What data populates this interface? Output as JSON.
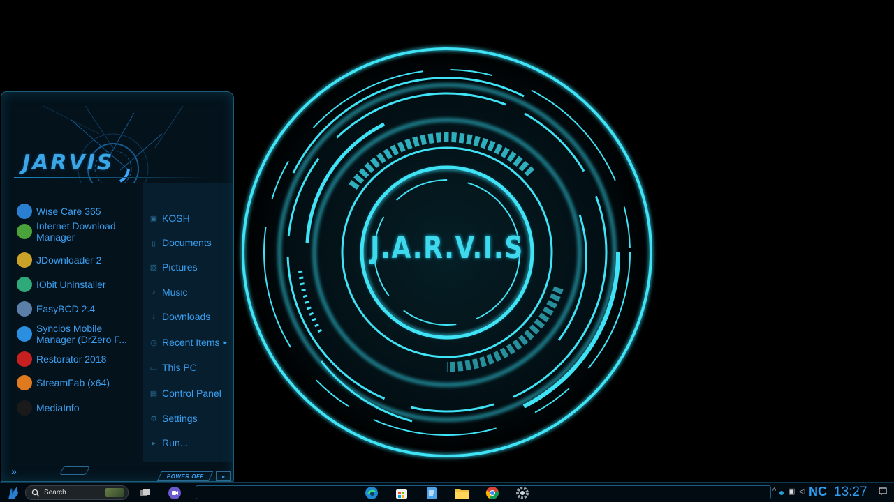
{
  "desktop": {
    "title": "J.A.R.V.I.S",
    "accent_color": "#3fd9ee"
  },
  "start_menu": {
    "brand": "JARVIS",
    "apps": [
      {
        "label": "Wise Care 365",
        "icon": "wise-care-icon",
        "color": "#2a7fd0"
      },
      {
        "label": "Internet Download Manager",
        "icon": "idm-icon",
        "color": "#4aa33a"
      },
      {
        "label": "JDownloader 2",
        "icon": "jdownloader-icon",
        "color": "#c9a227"
      },
      {
        "label": "IObit Uninstaller",
        "icon": "iobit-uninstaller-icon",
        "color": "#2fa87a"
      },
      {
        "label": "EasyBCD 2.4",
        "icon": "easybcd-icon",
        "color": "#5a7fa8"
      },
      {
        "label": "Syncios Mobile Manager (DrZero F...",
        "icon": "syncios-icon",
        "color": "#2a8fe0"
      },
      {
        "label": "Restorator 2018",
        "icon": "restorator-icon",
        "color": "#c62020"
      },
      {
        "label": "StreamFab (x64)",
        "icon": "streamfab-icon",
        "color": "#e07a1e"
      },
      {
        "label": "MediaInfo",
        "icon": "mediainfo-icon",
        "color": "#1a1a1a"
      }
    ],
    "places": [
      {
        "label": "KOSH",
        "icon": "user-folder-icon",
        "glyph": "▣"
      },
      {
        "label": "Documents",
        "icon": "document-icon",
        "glyph": "▯"
      },
      {
        "label": "Pictures",
        "icon": "picture-icon",
        "glyph": "▧"
      },
      {
        "label": "Music",
        "icon": "music-icon",
        "glyph": "♪"
      },
      {
        "label": "Downloads",
        "icon": "download-icon",
        "glyph": "↓"
      },
      {
        "label": "Recent Items",
        "icon": "clock-icon",
        "glyph": "◷"
      },
      {
        "label": "This PC",
        "icon": "computer-icon",
        "glyph": "▭"
      },
      {
        "label": "Control Panel",
        "icon": "control-panel-icon",
        "glyph": "▤"
      },
      {
        "label": "Settings",
        "icon": "gear-icon",
        "glyph": "⚙"
      },
      {
        "label": "Run...",
        "icon": "run-icon",
        "glyph": "▸"
      }
    ],
    "expand_glyph": "»",
    "power_off_label": "POWER OFF",
    "power_arrow_glyph": "▸"
  },
  "taskbar": {
    "search_label": "Search",
    "apps": [
      {
        "icon": "task-view-icon"
      },
      {
        "icon": "chat-icon"
      },
      {
        "icon": "edge-icon"
      },
      {
        "icon": "microsoft-store-icon"
      },
      {
        "icon": "notepad-icon"
      },
      {
        "icon": "file-explorer-icon"
      },
      {
        "icon": "chrome-icon"
      },
      {
        "icon": "settings-icon"
      }
    ],
    "tray": {
      "chevron": "^",
      "language": "NC",
      "clock": "13:27"
    }
  }
}
